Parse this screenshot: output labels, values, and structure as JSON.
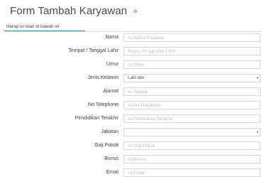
{
  "header": {
    "title": "Form Tambah Karyawan",
    "title_mark": "»",
    "tab_label": "Harap isi isian di bawah ini"
  },
  "form": {
    "fields": [
      {
        "label": "Nama",
        "type": "text",
        "placeholder": "Isi Nama Pegawai",
        "value": ""
      },
      {
        "label": "Tempat / Tanggal Lahir",
        "type": "text",
        "placeholder": "Bogor, 08 Agustus 1999",
        "value": ""
      },
      {
        "label": "Umur",
        "type": "text",
        "placeholder": "Isi Umur",
        "value": ""
      },
      {
        "label": "Jenis Kelamin",
        "type": "select",
        "value": "Laki-laki",
        "caret": "▾"
      },
      {
        "label": "Alamat",
        "type": "text",
        "placeholder": "Isi Alamat",
        "value": ""
      },
      {
        "label": "No Telephone",
        "type": "text",
        "placeholder": "Isi No Telephone",
        "value": ""
      },
      {
        "label": "Pendidikan Terakhir",
        "type": "text",
        "placeholder": "Isi Pendidikan Terakhir",
        "value": ""
      },
      {
        "label": "Jabatan",
        "type": "select",
        "value": "",
        "caret": "▾"
      },
      {
        "label": "Gaji Pokok",
        "type": "text",
        "placeholder": "Isi Gaji Pokok",
        "value": ""
      },
      {
        "label": "Bonus",
        "type": "text",
        "placeholder": "Isi Bonus",
        "value": ""
      },
      {
        "label": "Email",
        "type": "text",
        "placeholder": "Isi Email",
        "value": ""
      }
    ]
  }
}
